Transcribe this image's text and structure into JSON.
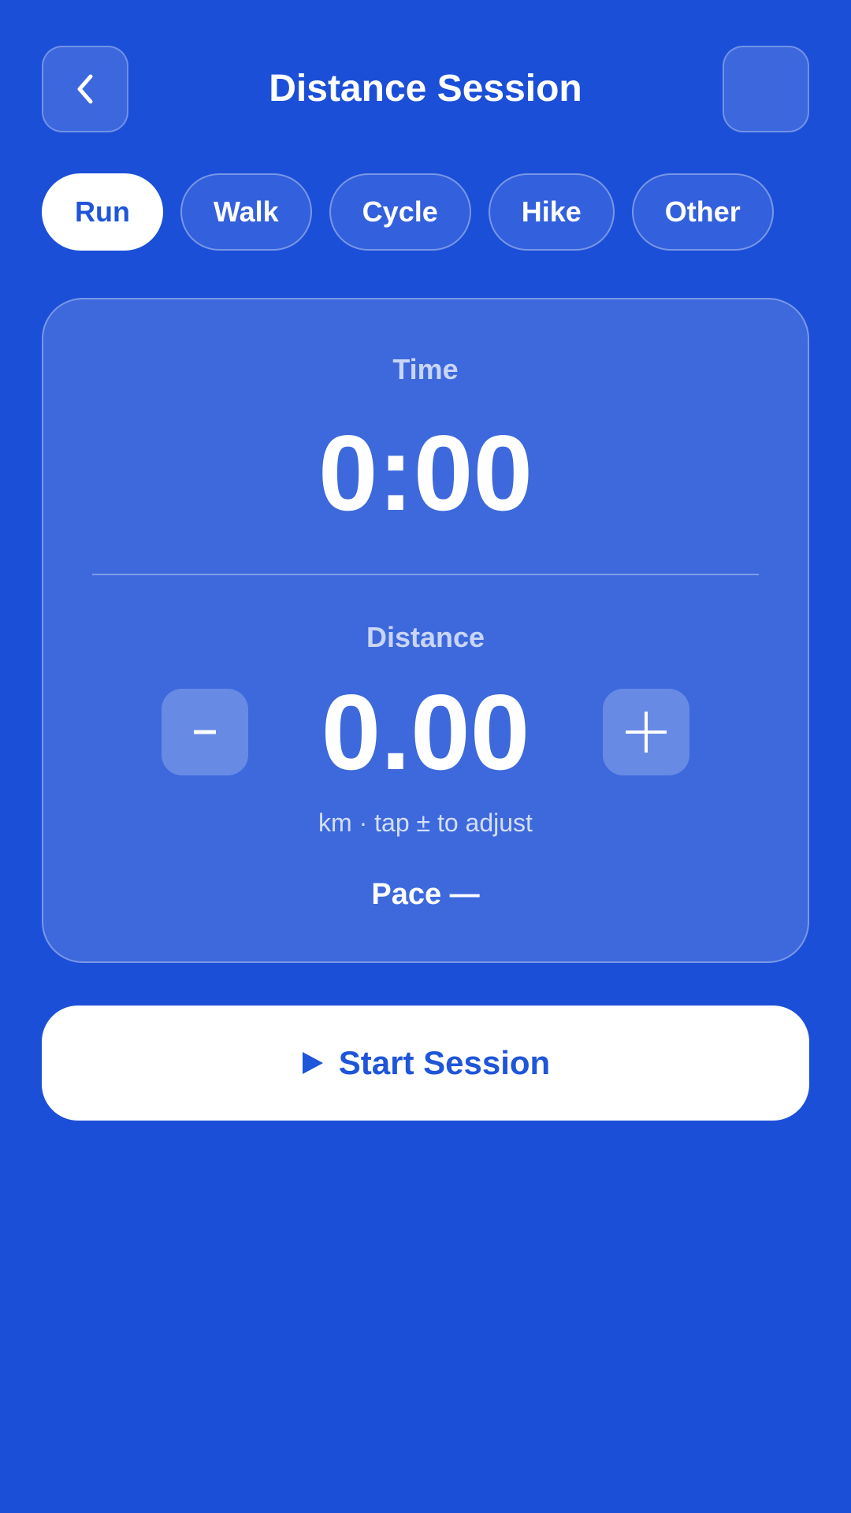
{
  "header": {
    "title": "Distance Session",
    "back_icon": "chevron-left-icon",
    "menu_icon": "blank"
  },
  "activities": [
    {
      "label": "Run",
      "selected": true
    },
    {
      "label": "Walk",
      "selected": false
    },
    {
      "label": "Cycle",
      "selected": false
    },
    {
      "label": "Hike",
      "selected": false
    },
    {
      "label": "Other",
      "selected": false
    }
  ],
  "session": {
    "time_label": "Time",
    "time_value": "0:00",
    "distance_label": "Distance",
    "distance_value": "0.00",
    "hint": "km · tap ± to adjust",
    "pace": "Pace —"
  },
  "start_button": {
    "label": "Start Session",
    "icon": "play-icon"
  },
  "colors": {
    "background": "#1c4fd8",
    "accent_text": "#1f55d9",
    "surface": "#ffffff"
  }
}
